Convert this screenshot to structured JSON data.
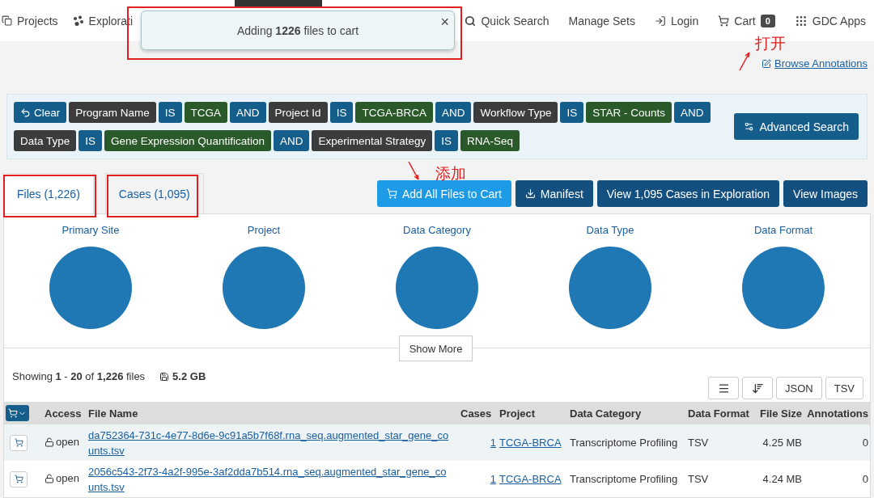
{
  "navbar": {
    "left": [
      {
        "label": "Projects",
        "kind": "projects"
      },
      {
        "label": "Explorati",
        "kind": "exploration"
      }
    ],
    "right": [
      {
        "label": "Quick Search",
        "kind": "search"
      },
      {
        "label": "Manage Sets",
        "kind": "plain"
      },
      {
        "label": "Login",
        "kind": "login"
      },
      {
        "label": "Cart",
        "kind": "cart",
        "badge": "0"
      },
      {
        "label": "GDC Apps",
        "kind": "apps"
      }
    ]
  },
  "toast": {
    "text": "Adding **1226** files to cart",
    "close": "×"
  },
  "browse_annotations": "Browse Annotations",
  "query": {
    "chips": [
      {
        "label": "Clear",
        "kind": "clear"
      },
      {
        "label": "Program Name",
        "kind": "field"
      },
      {
        "label": "IS",
        "kind": "op"
      },
      {
        "label": "TCGA",
        "kind": "value"
      },
      {
        "label": "AND",
        "kind": "op"
      },
      {
        "label": "Project Id",
        "kind": "field"
      },
      {
        "label": "IS",
        "kind": "op"
      },
      {
        "label": "TCGA-BRCA",
        "kind": "value"
      },
      {
        "label": "AND",
        "kind": "op"
      },
      {
        "label": "Workflow Type",
        "kind": "field"
      },
      {
        "label": "IS",
        "kind": "op"
      },
      {
        "label": "STAR - Counts",
        "kind": "value"
      },
      {
        "label": "AND",
        "kind": "op"
      },
      {
        "label": "Data Type",
        "kind": "field"
      },
      {
        "label": "IS",
        "kind": "op"
      },
      {
        "label": "Gene Expression Quantification",
        "kind": "value"
      },
      {
        "label": "AND",
        "kind": "op"
      },
      {
        "label": "Experimental Strategy",
        "kind": "field"
      },
      {
        "label": "IS",
        "kind": "op"
      },
      {
        "label": "RNA-Seq",
        "kind": "value"
      }
    ],
    "advanced": "Advanced Search"
  },
  "tabs": [
    {
      "label": "Files (1,226)",
      "selected": true
    },
    {
      "label": "Cases (1,095)",
      "selected": false
    }
  ],
  "actions": [
    {
      "label": "Add All Files to Cart",
      "kind": "cart"
    },
    {
      "label": "Manifest",
      "kind": "download"
    },
    {
      "label": "View 1,095 Cases in Exploration",
      "kind": "plain"
    },
    {
      "label": "View Images",
      "kind": "plain"
    }
  ],
  "charts": [
    {
      "title": "Primary Site"
    },
    {
      "title": "Project"
    },
    {
      "title": "Data Category"
    },
    {
      "title": "Data Type"
    },
    {
      "title": "Data Format"
    }
  ],
  "show_more": "Show More",
  "summary": {
    "text": "Showing **1** - **20** of **1,226** files",
    "size": "5.2 GB"
  },
  "table_tools": [
    {
      "kind": "list"
    },
    {
      "kind": "sort"
    },
    {
      "kind": "text",
      "label": "JSON"
    },
    {
      "kind": "text",
      "label": "TSV"
    }
  ],
  "table": {
    "columns": [
      "Access",
      "File Name",
      "Cases",
      "Project",
      "Data Category",
      "Data Format",
      "File Size",
      "Annotations"
    ],
    "rows": [
      {
        "access": "open",
        "file_name": "da752364-731c-4e77-8d6e-9c91a5b7f68f.rna_seq.augmented_star_gene_counts.tsv",
        "cases": "1",
        "project": "TCGA-BRCA",
        "data_category": "Transcriptome Profiling",
        "data_format": "TSV",
        "file_size": "4.25 MB",
        "annotations": "0"
      },
      {
        "access": "open",
        "file_name": "2056c543-2f73-4a2f-995e-3af2dda7b514.rna_seq.augmented_star_gene_counts.tsv",
        "cases": "1",
        "project": "TCGA-BRCA",
        "data_category": "Transcriptome Profiling",
        "data_format": "TSV",
        "file_size": "4.24 MB",
        "annotations": "0"
      }
    ]
  },
  "annotations": [
    {
      "text": "打开",
      "kind": "cart"
    },
    {
      "text": "添加",
      "kind": "add"
    }
  ]
}
